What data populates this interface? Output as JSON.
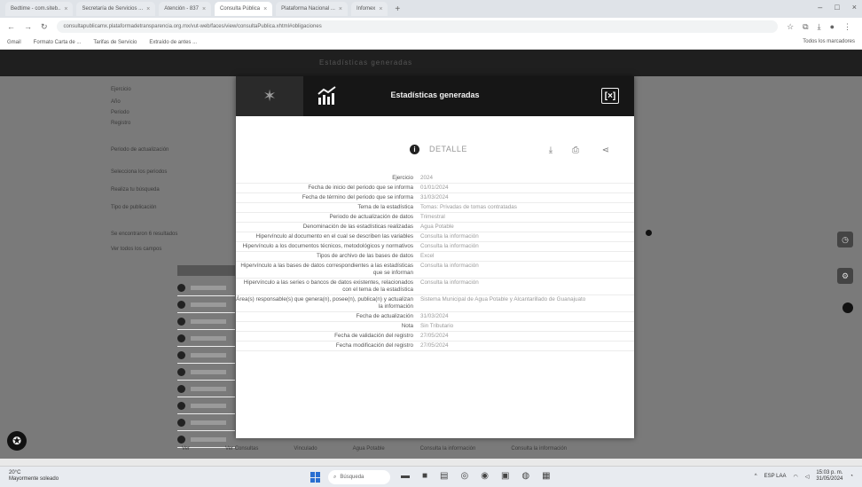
{
  "browser": {
    "tabs": [
      {
        "label": "Bedtime - com.siteb..",
        "active": false
      },
      {
        "label": "Secretaría de Servicios ...",
        "active": false
      },
      {
        "label": "Atención - 837",
        "active": false
      },
      {
        "label": "Consulta Pública",
        "active": true
      },
      {
        "label": "Plataforma Nacional ...",
        "active": false
      },
      {
        "label": "Infomex",
        "active": false
      }
    ],
    "new_tab": "+",
    "window_controls": [
      "–",
      "□",
      "×"
    ],
    "url": "consultapublicamx.plataformadetransparencia.org.mx/vut-web/faces/view/consultaPublica.xhtml#obligaciones",
    "bookmarks": [
      "Gmail",
      "Formato Carta de ...",
      "Tarifas de Servicio",
      "Extraído de antes ..."
    ],
    "bookmarks_right": "Todos los marcadores"
  },
  "background_page": {
    "header_text": "Estadísticas generadas",
    "labels": [
      "Ejercicio",
      "Año",
      "Periodo",
      "Registro",
      "Periodo de actualización",
      "Selecciona los periodos",
      "Realiza tu búsqueda",
      "Tipo de publicación",
      "Se encontraron 6 resultados",
      "Ver todos los campos"
    ],
    "bottom_cells": [
      "Ver",
      "Ver Consultas",
      "Vinculado",
      "Agua Potable",
      "Consulta la información",
      "Consulta la información"
    ]
  },
  "modal": {
    "title": "Estadísticas generadas",
    "close_label": "[×]",
    "detail_label": "DETALLE",
    "rows": [
      {
        "label": "Ejercicio",
        "value": "2024"
      },
      {
        "label": "Fecha de inicio del periodo que se informa",
        "value": "01/01/2024"
      },
      {
        "label": "Fecha de término del periodo que se informa",
        "value": "31/03/2024"
      },
      {
        "label": "Tema de la estadística",
        "value": "Tomas: Privadas de tomas contratadas"
      },
      {
        "label": "Periodo de actualización de datos",
        "value": "Trimestral"
      },
      {
        "label": "Denominación de las estadísticas realizadas",
        "value": "Agua Potable"
      },
      {
        "label": "Hipervínculo al documento en el cual se describen las variables",
        "value": "Consulta la información"
      },
      {
        "label": "Hipervínculo a los documentos técnicos, metodológicos y normativos",
        "value": "Consulta la información"
      },
      {
        "label": "Tipos de archivo de las bases de datos",
        "value": "Excel"
      },
      {
        "label": "Hipervínculo a las bases de datos correspondientes a las estadísticas que se informan",
        "value": "Consulta la información"
      },
      {
        "label": "Hipervínculo a las series o bancos de datos existentes, relacionados con el tema de la estadística",
        "value": "Consulta la información"
      },
      {
        "label": "Área(s) responsable(s) que genera(n), posee(n), publica(n) y actualizan la información",
        "value": "Sistema Municipal de Agua Potable y Alcantarillado de Guanajuato"
      },
      {
        "label": "Fecha de actualización",
        "value": "31/03/2024"
      },
      {
        "label": "Nota",
        "value": "Sin Tributario"
      },
      {
        "label": "Fecha de validación del registro",
        "value": "27/05/2024"
      },
      {
        "label": "Fecha modificación del registro",
        "value": "27/05/2024"
      }
    ]
  },
  "taskbar": {
    "weather_temp": "20°C",
    "weather_desc": "Mayormente soleado",
    "search_placeholder": "Búsqueda",
    "time": "15:03 p. m.",
    "date": "31/05/2024",
    "lang": "ESP LAA"
  },
  "colors": {
    "modal_header": "#161616",
    "overlay": "#7a7a7a",
    "accent_start": "#2a6fd1"
  }
}
